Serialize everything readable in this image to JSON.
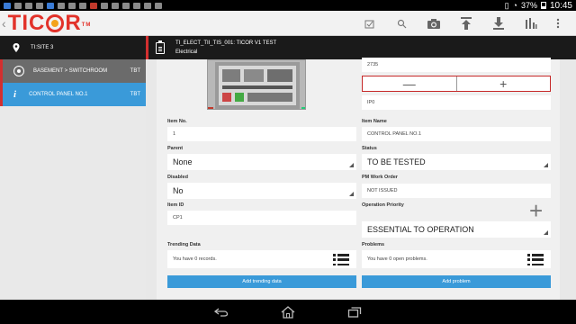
{
  "status_bar": {
    "battery": "37%",
    "time": "10:45"
  },
  "app": {
    "logo_text": "TICOR",
    "logo_tm": "TM",
    "colors": {
      "brand_red": "#e2322a",
      "brand_orange": "#f3a31b",
      "accent_blue": "#3a9ad9"
    },
    "action_icons": [
      "clipboard-check-icon",
      "search-icon",
      "camera-icon",
      "upload-icon",
      "download-icon",
      "bar-chart-icon",
      "overflow-menu-icon"
    ]
  },
  "sidebar": {
    "site": "TI:SITE 3",
    "location": {
      "label": "BASEMENT > SWITCHROOM",
      "tag": "TBT"
    },
    "item": {
      "label": "CONTROL PANEL NO.1",
      "tag": "TBT"
    }
  },
  "detail_header": {
    "line1": "TI_ELECT_TII_TIS_001: TICOR V1 TEST",
    "line2": "Electrical"
  },
  "form": {
    "quantity": "2735",
    "ip_rating": "IP0",
    "item_no": {
      "label": "Item No.",
      "value": "1"
    },
    "item_name": {
      "label": "Item Name",
      "value": "CONTROL PANEL NO.1"
    },
    "parent": {
      "label": "Parent",
      "value": "None"
    },
    "status": {
      "label": "Status",
      "value": "TO BE TESTED"
    },
    "disabled": {
      "label": "Disabled",
      "value": "No"
    },
    "pm_work_order": {
      "label": "PM Work Order",
      "value": "NOT ISSUED"
    },
    "item_id": {
      "label": "Item ID",
      "value": "CP1"
    },
    "operation_priority": {
      "label": "Operation Priority",
      "value": "ESSENTIAL TO OPERATION"
    },
    "trending": {
      "label": "Trending Data",
      "value": "You have 0 records.",
      "button": "Add trending data"
    },
    "problems": {
      "label": "Problems",
      "value": "You have 0 open problems.",
      "button": "Add problem"
    }
  }
}
